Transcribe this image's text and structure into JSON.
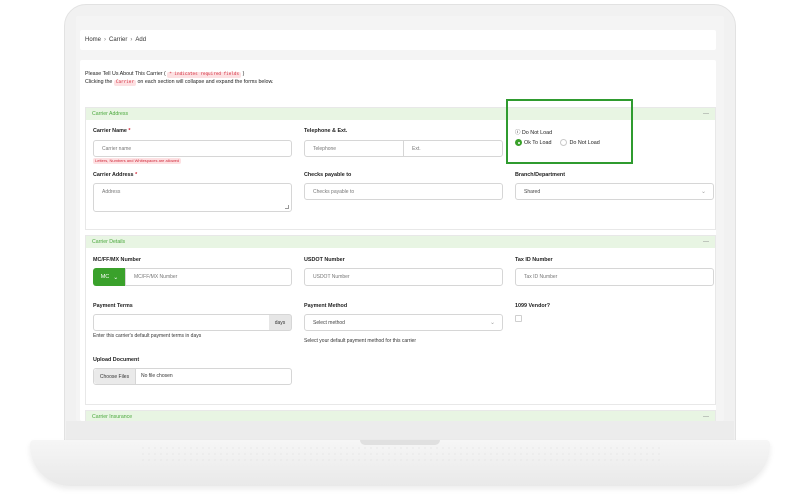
{
  "breadcrumb": [
    "Home",
    "Carrier",
    "Add"
  ],
  "intro": {
    "line1_prefix": "Please Tell Us About This Carrier (",
    "line1_chip": "* indicates required fields",
    "line1_suffix": ")",
    "line2_prefix": "Clicking the",
    "line2_chip": "Carrier",
    "line2_suffix": "on each section will collapse and expand the forms below."
  },
  "sections": {
    "address": {
      "title": "Carrier Address",
      "collapse": "—"
    },
    "details": {
      "title": "Carrier Details",
      "collapse": "—"
    },
    "insurance": {
      "title": "Carrier Insurance",
      "collapse": "—"
    }
  },
  "address": {
    "carrier_name_label": "Carrier Name",
    "required_mark": "*",
    "carrier_name_placeholder": "Carrier name",
    "carrier_name_hint": "Letters, Numbers and Whitespaces are allowed",
    "telephone_label": "Telephone & Ext.",
    "telephone_placeholder": "Telephone",
    "ext_placeholder": "Ext.",
    "do_not_load_icon_glyph": "ⓘ",
    "do_not_load_label": "Do Not Load",
    "radio_ok": "Ok To Load",
    "radio_dnl": "Do Not Load",
    "carrier_address_label": "Carrier Address",
    "carrier_address_placeholder": "Address",
    "checks_label": "Checks payable to",
    "checks_placeholder": "Checks payable to",
    "branch_label": "Branch/Department",
    "branch_value": "Shared"
  },
  "details": {
    "mc_label": "MC/FF/MX Number",
    "mc_button": "MC",
    "mc_placeholder": "MC/FF/MX Number",
    "usdot_label": "USDOT Number",
    "usdot_placeholder": "USDOT Number",
    "taxid_label": "Tax ID Number",
    "taxid_placeholder": "Tax ID Number",
    "payment_terms_label": "Payment Terms",
    "days_addon": "days",
    "payment_terms_hint": "Enter this carrier's default payment terms in days",
    "payment_method_label": "Payment Method",
    "payment_method_value": "Select method",
    "payment_method_hint": "Select your default payment method for this carrier",
    "vendor_label": "1099 Vendor?",
    "upload_label": "Upload Document",
    "choose_files": "Choose Files",
    "no_file": "No file chosen"
  },
  "icons": {
    "chevron": "chevron-down-icon",
    "info": "info-icon"
  },
  "colors": {
    "accent": "#3aa12b",
    "section_head_bg": "#e8f5e3",
    "required": "#d12a3b",
    "highlight": "#2f9b2f"
  }
}
